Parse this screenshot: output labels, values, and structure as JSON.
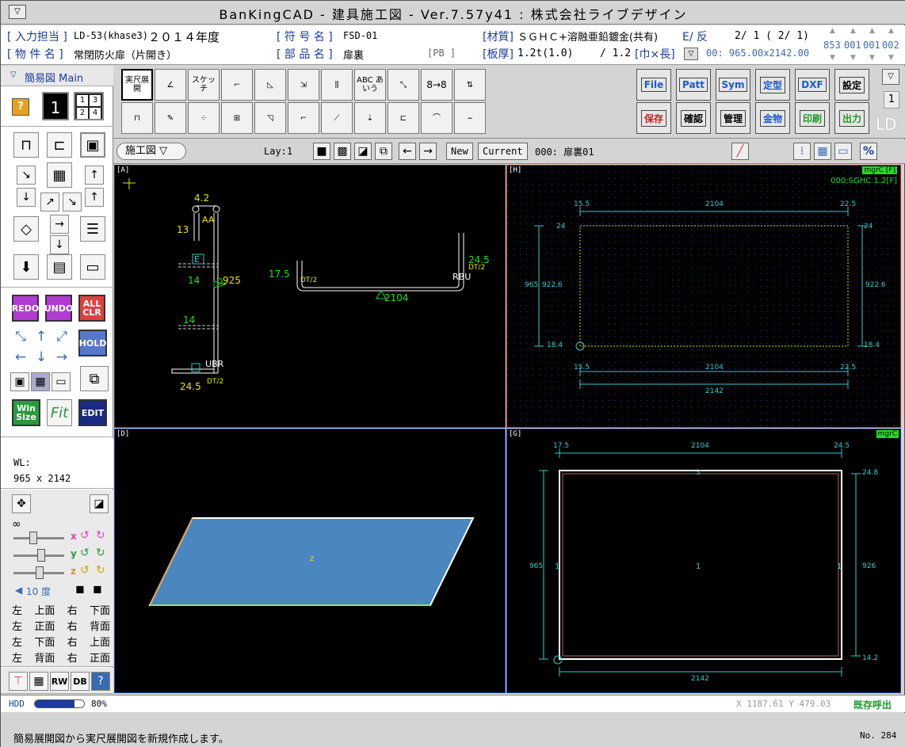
{
  "app": {
    "title": "BanKingCAD - 建具施工図 - Ver.7.57y41 : 株式会社ライブデザイン",
    "menu_glyph": "▽"
  },
  "info": {
    "input_label": "[ 入力担当 ]",
    "input_value": "LD-53(khase3)",
    "year": "２０１４年度",
    "property_label": "[ 物 件 名 ]",
    "property_value": "常閉防火扉（片開き）",
    "code_label": "[ 符 号 名 ]",
    "code_value": "FSD-01",
    "part_label": "[ 部 品 名 ]",
    "part_value": "扉裏",
    "pb": "[PB  ]",
    "material_label": "[材質]",
    "material_value": "ＳＧＨＣ+溶融亜鉛鍍金(共有)",
    "front_back": "E/ 反",
    "page": "2/  1 ( 2/  1)",
    "thickness_label": "[板厚]",
    "thickness_value": "1.2t(1.0)",
    "thickness_value2": "/ 1.2",
    "size_label": "[巾×長]",
    "size_value": "00: 965.00x2142.00",
    "counters": [
      "853",
      "001",
      "001",
      "002"
    ]
  },
  "left": {
    "mode_title": "簡易図 Main",
    "help_glyph": "?",
    "view_one": "1",
    "view_grid": [
      "1",
      "3",
      "2",
      "4"
    ],
    "tool_letters": [
      "A",
      "B",
      "C",
      "D",
      "E",
      "F",
      "G",
      "H",
      "I",
      "J",
      "K"
    ],
    "buttons": {
      "redo": "REDO",
      "undo": "UNDO",
      "allclr": "ALL CLR",
      "hold": "HOLD",
      "winsize": "Win Size",
      "edit": "EDIT"
    },
    "wl_label": "WL:",
    "wl_value": "965 x 2142",
    "infinity": "∞",
    "axis": [
      "x",
      "y",
      "z"
    ],
    "degree": "10 度",
    "views": [
      [
        "左",
        "上面",
        "右",
        "下面"
      ],
      [
        "左",
        "正面",
        "右",
        "背面"
      ],
      [
        "左",
        "下面",
        "右",
        "上面"
      ],
      [
        "左",
        "背面",
        "右",
        "正面"
      ]
    ],
    "bottom_tools": [
      "RW",
      "DB",
      "?"
    ]
  },
  "toolbar": {
    "row1": [
      "実尺展開",
      "",
      "スケッチ",
      "",
      "",
      "",
      "",
      "ABC あいう",
      "",
      "8→8",
      ""
    ],
    "right_row1": [
      "File",
      "Patt",
      "Sym",
      "定型",
      "DXF",
      "設定"
    ],
    "right_row2": [
      "保存",
      "確認",
      "管理",
      "金物",
      "印刷",
      "出力"
    ],
    "side_num": "1",
    "ld": "LD"
  },
  "bar2": {
    "drawing_select": "施工図 ▽",
    "layer": "Lay:1",
    "new_btn": "New",
    "current_btn": "Current",
    "current_part": "000: 扉裏01",
    "percent": "%"
  },
  "panes": {
    "A": {
      "label": "[A]",
      "dims": [
        "4.2",
        "13",
        "14",
        "925",
        "14",
        "24.5",
        "17.5",
        "24.5",
        "2104"
      ],
      "tags": [
        "AA",
        "E",
        "D",
        "UBR",
        "DT/2",
        "RBU",
        "DT/2",
        "DT/2"
      ]
    },
    "H": {
      "label": "[H]",
      "tag1": "mgrC [F]",
      "tag2": "000;SGHC 1.2[F]",
      "top": [
        "15.5",
        "2104",
        "22.5"
      ],
      "bottom": [
        "15.5",
        "2104",
        "22.5"
      ],
      "total": "2142",
      "left": [
        "24",
        "965",
        "922.6",
        "18.4"
      ],
      "right": [
        "24",
        "922.6",
        "18.4"
      ]
    },
    "D": {
      "label": "[D]",
      "axis": "z"
    },
    "G": {
      "label": "[G]",
      "tag": "mgrC",
      "top": [
        "17.5",
        "2104",
        "24.5"
      ],
      "right": [
        "24.8",
        "926",
        "14.2"
      ],
      "left": "965",
      "bottom": "2142",
      "ids": [
        "1",
        "1",
        "1",
        "3"
      ]
    }
  },
  "status": {
    "hdd_label": "HDD",
    "hdd_percent": "80%",
    "hdd_fill": 0.8,
    "coords": "X 1187.61 Y  479.03",
    "mode": "既存呼出"
  },
  "message": {
    "text": "簡易展開図から実尺展開図を新規作成します。",
    "number": "No. 284"
  },
  "colors": {
    "label_blue": "#1a3c9c",
    "cad_green": "#22dd22",
    "cad_yellow": "#e6e600",
    "cad_cyan": "#33cccc",
    "plane_fill": "#4a86c0"
  }
}
